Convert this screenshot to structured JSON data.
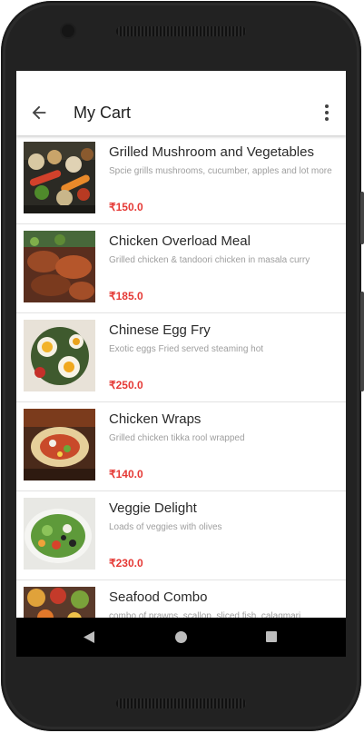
{
  "app_bar": {
    "title": "My Cart",
    "back_icon": "arrow-back-icon",
    "menu_icon": "more-vert-icon"
  },
  "cart_items": [
    {
      "name": "Grilled Mushroom and Vegetables",
      "description": "Spcie grills mushrooms, cucumber, apples and lot more",
      "price": "₹150.0"
    },
    {
      "name": "Chicken Overload Meal",
      "description": "Grilled chicken & tandoori chicken in masala curry",
      "price": "₹185.0"
    },
    {
      "name": "Chinese Egg Fry",
      "description": "Exotic eggs Fried served steaming hot",
      "price": "₹250.0"
    },
    {
      "name": "Chicken Wraps",
      "description": "Grilled chicken tikka rool wrapped",
      "price": "₹140.0"
    },
    {
      "name": "Veggie Delight",
      "description": "Loads of veggies with olives",
      "price": "₹230.0"
    },
    {
      "name": "Seafood Combo",
      "description": "combo of prawns, scallop, sliced fish, calagmari",
      "price": ""
    }
  ],
  "colors": {
    "price": "#e53935",
    "nav_bar": "#000000",
    "phone_frame": "#2b2b2b"
  },
  "nav_bar": {
    "back_icon": "nav-back-triangle-icon",
    "home_icon": "nav-home-circle-icon",
    "recents_icon": "nav-recents-square-icon"
  }
}
